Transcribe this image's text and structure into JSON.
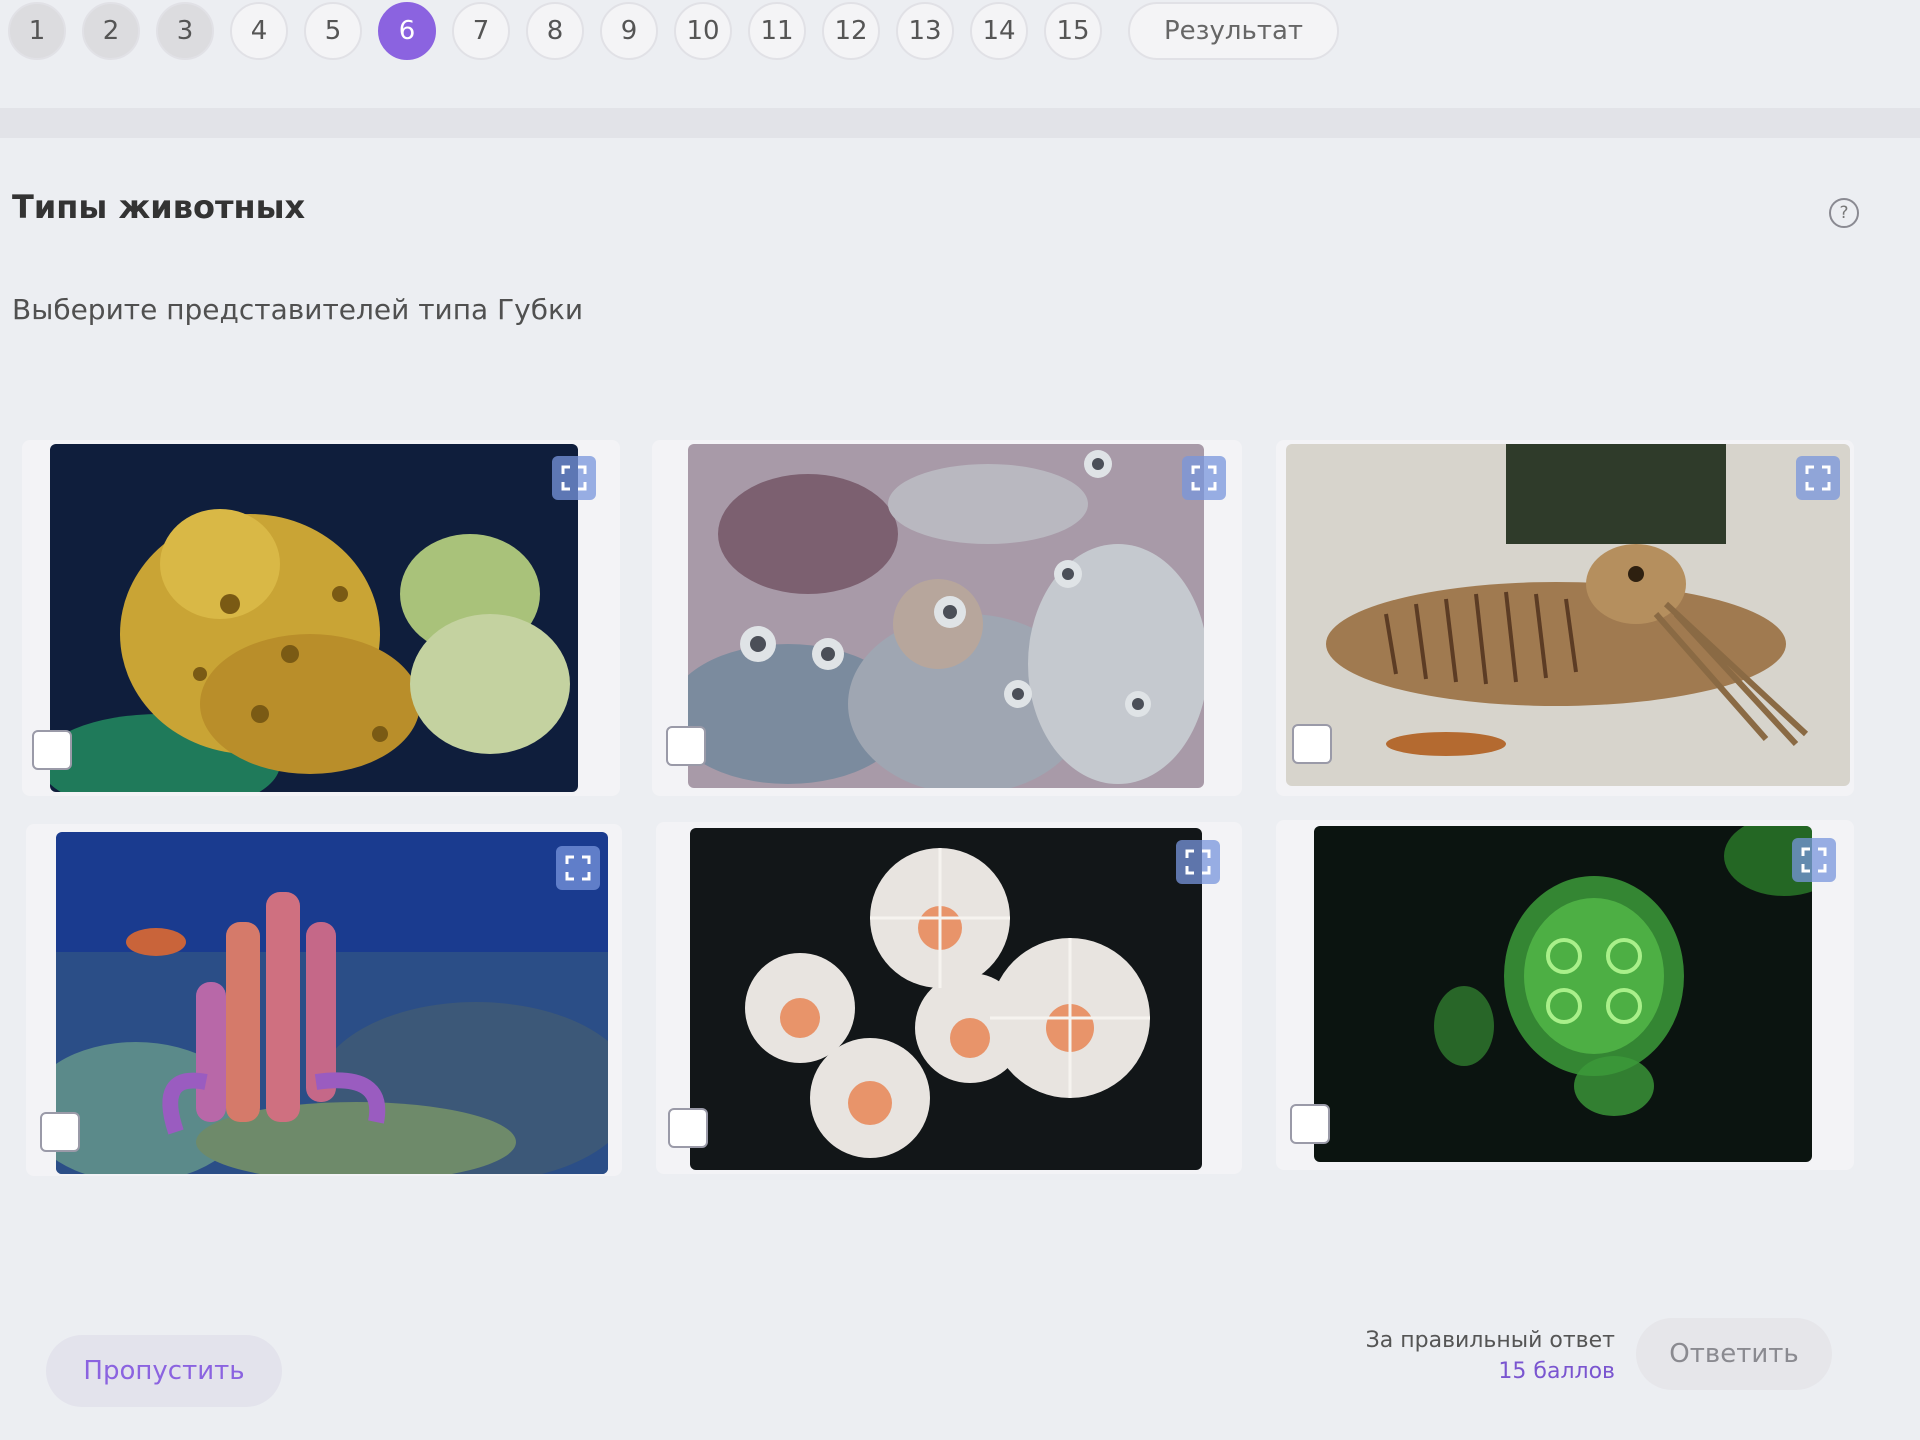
{
  "pagination": {
    "pages": [
      "1",
      "2",
      "3",
      "4",
      "5",
      "6",
      "7",
      "8",
      "9",
      "10",
      "11",
      "12",
      "13",
      "14",
      "15"
    ],
    "current": "6",
    "result_label": "Результат"
  },
  "task": {
    "title": "Типы животных",
    "help_symbol": "?",
    "question": "Выберите представителей типа Губки"
  },
  "options": [
    {
      "image": "yellow-sponge-photo",
      "checked": false
    },
    {
      "image": "tube-sponges-photo",
      "checked": false
    },
    {
      "image": "cuttlefish-photo",
      "checked": false
    },
    {
      "image": "purple-tube-sponge-photo",
      "checked": false
    },
    {
      "image": "sea-anemones-photo",
      "checked": false
    },
    {
      "image": "jellyfish-photo",
      "checked": false
    }
  ],
  "footer": {
    "skip_label": "Пропустить",
    "reward_label": "За правильный ответ",
    "reward_points": "15 баллов",
    "answer_label": "Ответить"
  },
  "colors": {
    "accent": "#8b63e0",
    "expand_bg": "#7896dc"
  }
}
